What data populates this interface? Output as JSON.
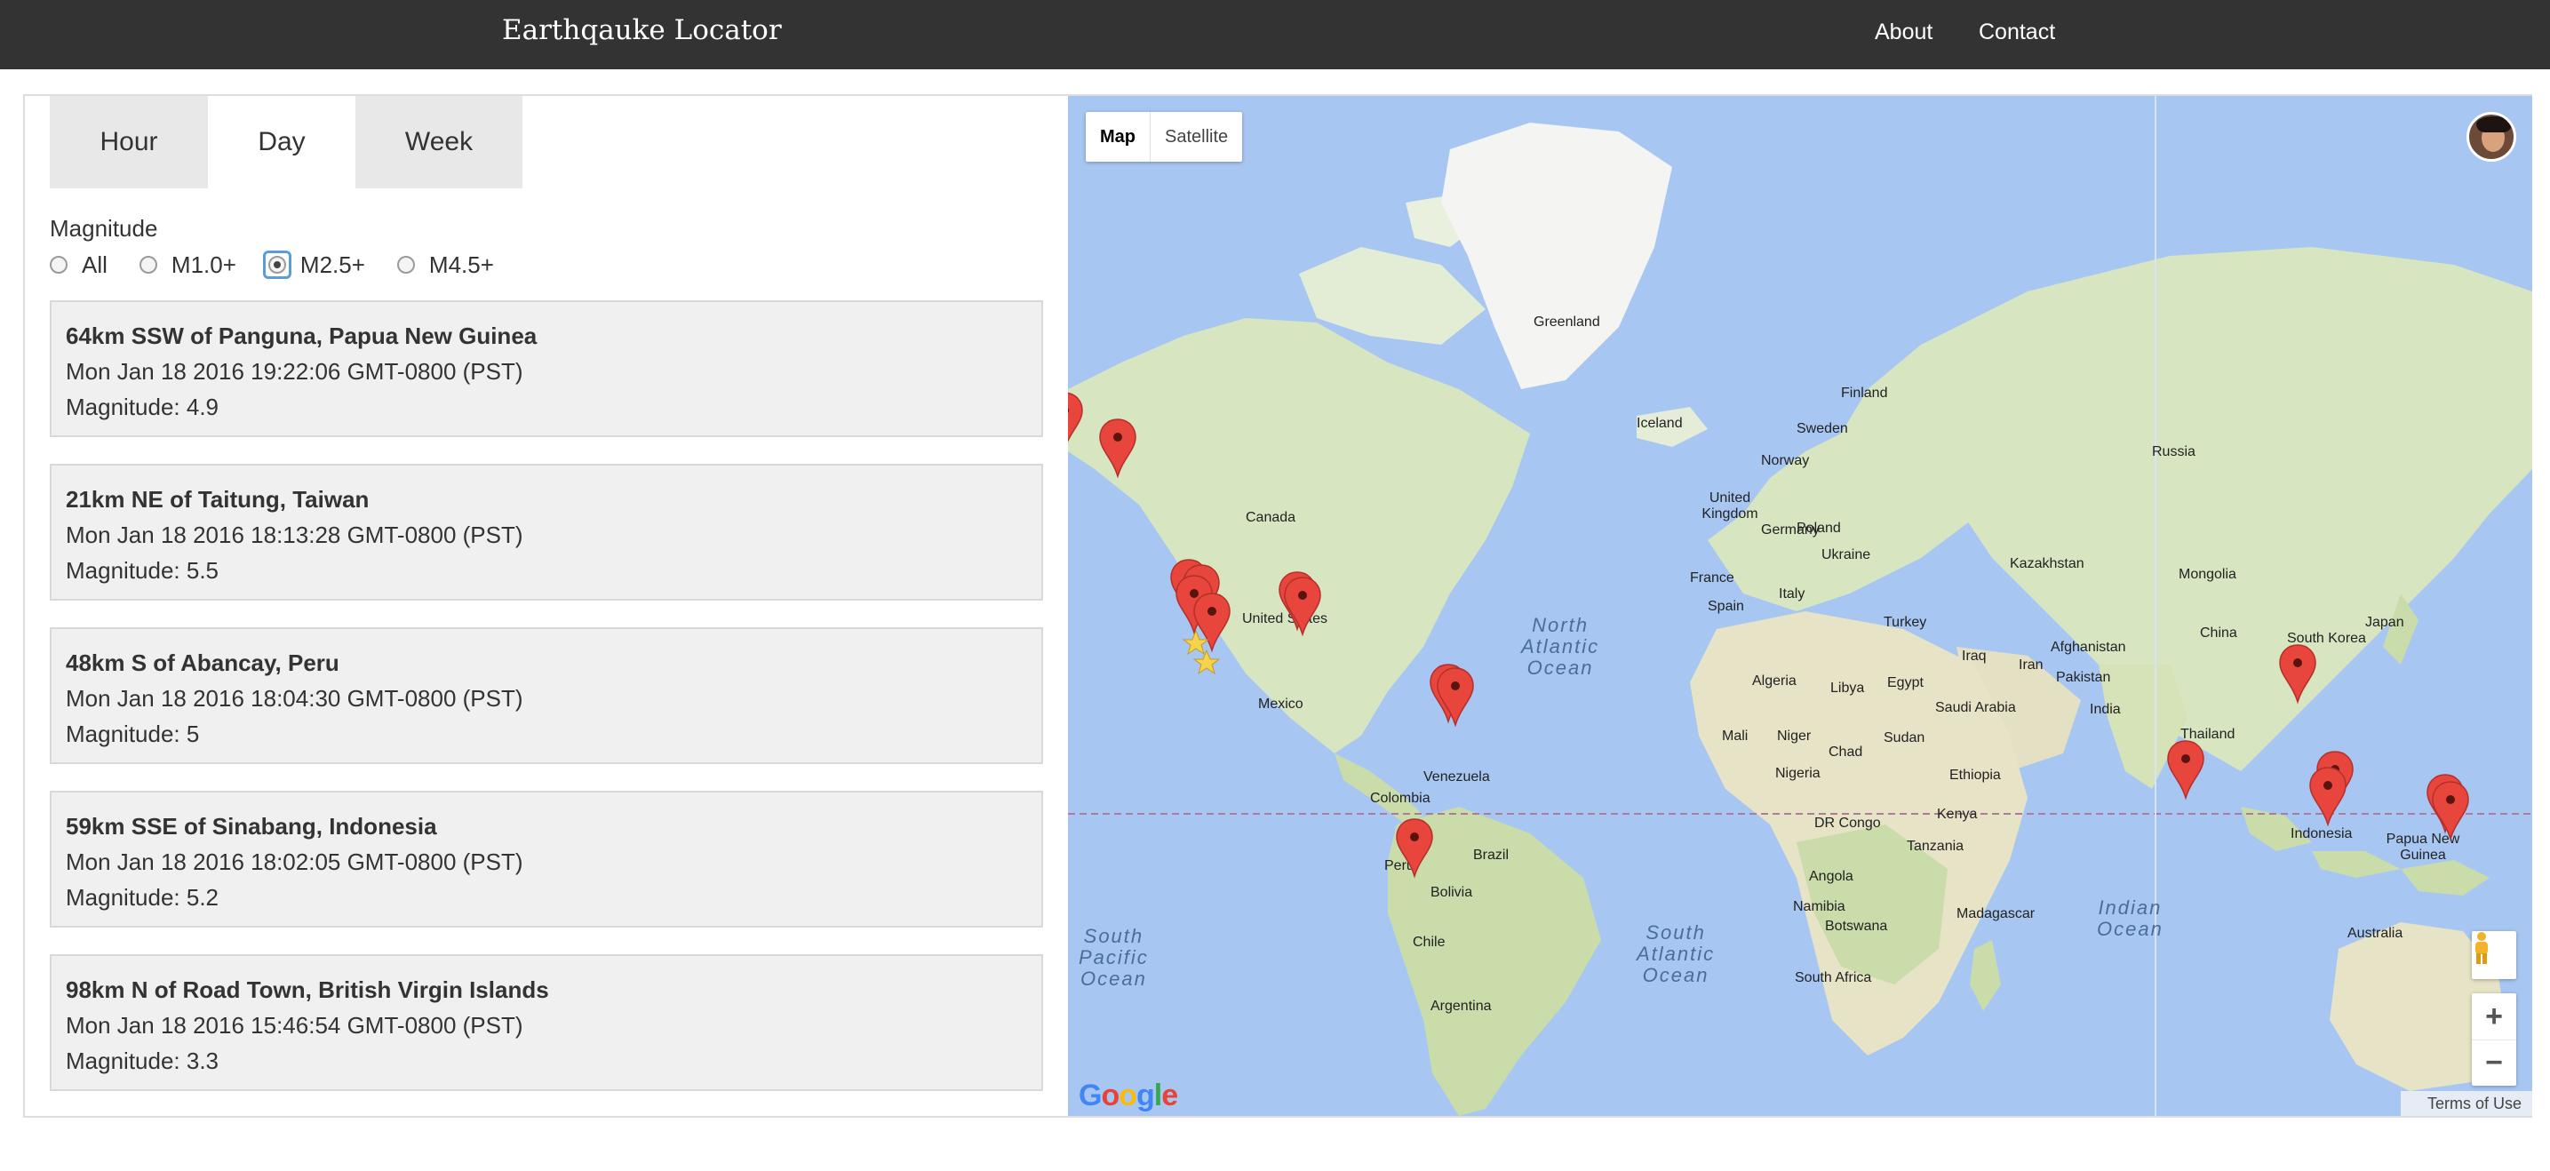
{
  "header": {
    "brand": "Earthqauke Locator",
    "nav": {
      "about": "About",
      "contact": "Contact"
    }
  },
  "tabs": [
    {
      "label": "Hour",
      "active": false
    },
    {
      "label": "Day",
      "active": true
    },
    {
      "label": "Week",
      "active": false
    }
  ],
  "magnitude": {
    "label": "Magnitude",
    "options": [
      {
        "label": "All",
        "checked": false
      },
      {
        "label": "M1.0+",
        "checked": false
      },
      {
        "label": "M2.5+",
        "checked": true
      },
      {
        "label": "M4.5+",
        "checked": false
      }
    ]
  },
  "quakes": [
    {
      "place": "64km SSW of Panguna, Papua New Guinea",
      "time": "Mon Jan 18 2016 19:22:06 GMT-0800 (PST)",
      "magnitude": "Magnitude: 4.9"
    },
    {
      "place": "21km NE of Taitung, Taiwan",
      "time": "Mon Jan 18 2016 18:13:28 GMT-0800 (PST)",
      "magnitude": "Magnitude: 5.5"
    },
    {
      "place": "48km S of Abancay, Peru",
      "time": "Mon Jan 18 2016 18:04:30 GMT-0800 (PST)",
      "magnitude": "Magnitude: 5"
    },
    {
      "place": "59km SSE of Sinabang, Indonesia",
      "time": "Mon Jan 18 2016 18:02:05 GMT-0800 (PST)",
      "magnitude": "Magnitude: 5.2"
    },
    {
      "place": "98km N of Road Town, British Virgin Islands",
      "time": "Mon Jan 18 2016 15:46:54 GMT-0800 (PST)",
      "magnitude": "Magnitude: 3.3"
    }
  ],
  "map": {
    "type_buttons": {
      "map": "Map",
      "satellite": "Satellite"
    },
    "zoom_in": "+",
    "zoom_out": "−",
    "google_logo": [
      "G",
      "o",
      "o",
      "g",
      "l",
      "e"
    ],
    "terms": "Terms of Use",
    "labels": {
      "greenland": "Greenland",
      "iceland": "Iceland",
      "finland": "Finland",
      "sweden": "Sweden",
      "norway": "Norway",
      "russia": "Russia",
      "uk": "United Kingdom",
      "poland": "Poland",
      "germany": "Germany",
      "ukraine": "Ukraine",
      "kazakhstan": "Kazakhstan",
      "mongolia": "Mongolia",
      "france": "France",
      "spain": "Spain",
      "italy": "Italy",
      "turkey": "Turkey",
      "china": "China",
      "south_korea": "South Korea",
      "japan": "Japan",
      "iraq": "Iraq",
      "iran": "Iran",
      "afghanistan": "Afghanistan",
      "pakistan": "Pakistan",
      "india": "India",
      "thailand": "Thailand",
      "algeria": "Algeria",
      "libya": "Libya",
      "egypt": "Egypt",
      "saudi_arabia": "Saudi Arabia",
      "mali": "Mali",
      "niger": "Niger",
      "chad": "Chad",
      "sudan": "Sudan",
      "ethiopia": "Ethiopia",
      "nigeria": "Nigeria",
      "kenya": "Kenya",
      "dr_congo": "DR Congo",
      "tanzania": "Tanzania",
      "angola": "Angola",
      "namibia": "Namibia",
      "botswana": "Botswana",
      "madagascar": "Madagascar",
      "south_africa": "South Africa",
      "indonesia": "Indonesia",
      "papua_new_guinea": "Papua New Guinea",
      "australia": "Australia",
      "canada": "Canada",
      "united_states": "United States",
      "mexico": "Mexico",
      "venezuela": "Venezuela",
      "colombia": "Colombia",
      "peru": "Peru",
      "brazil": "Brazil",
      "bolivia": "Bolivia",
      "chile": "Chile",
      "argentina": "Argentina"
    },
    "oceans": {
      "north_atlantic": [
        "North",
        "Atlantic",
        "Ocean"
      ],
      "south_pacific": [
        "South",
        "Pacific",
        "Ocean"
      ],
      "south_atlantic": [
        "South",
        "Atlantic",
        "Ocean"
      ],
      "indian": [
        "Indian",
        "Ocean"
      ]
    },
    "colors": {
      "water": "#a7c7f2",
      "land": "#d7e6c1",
      "ice": "#f4f4f2",
      "marker": "#e8453c",
      "equator": "#b07a9a"
    }
  }
}
